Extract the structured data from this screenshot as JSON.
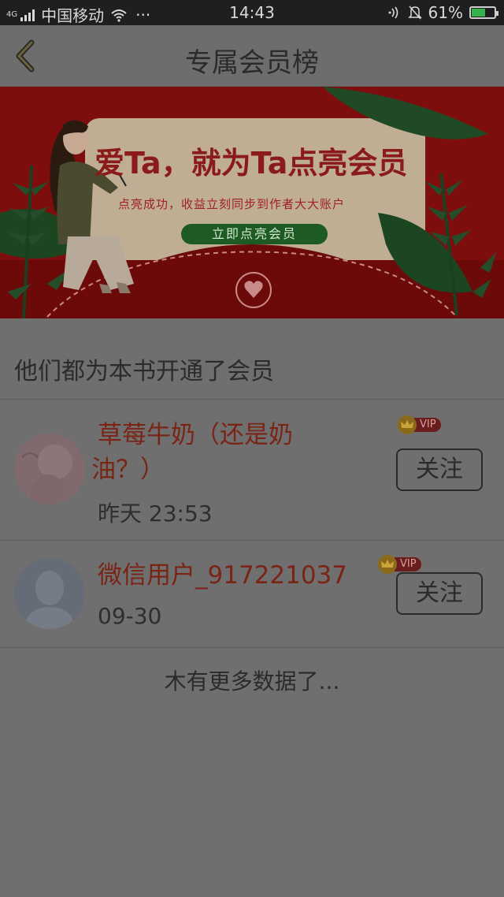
{
  "status_bar": {
    "network_type": "4G",
    "carrier": "中国移动",
    "more": "···",
    "time": "14:43",
    "battery": "61%",
    "battery_level": 0.61
  },
  "header": {
    "title": "专属会员榜"
  },
  "banner": {
    "headline": "爱Ta，就为Ta点亮会员",
    "subtitle": "点亮成功，收益立刻同步到作者大大账户",
    "cta": "立即点亮会员"
  },
  "section": {
    "title": "他们都为本书开通了会员"
  },
  "members": [
    {
      "name_line1": "草莓牛奶（还是奶",
      "name_line2": "油？）",
      "time": "昨天 23:53",
      "badge": "VIP",
      "follow_label": "关注"
    },
    {
      "name": "微信用户_917221037",
      "time": "09-30",
      "badge": "VIP",
      "follow_label": "关注"
    }
  ],
  "footer": {
    "no_more": "木有更多数据了..."
  },
  "colors": {
    "overlay_background": "#6f6f6f",
    "banner_red": "#7d0a0a",
    "name_red": "#7a2416",
    "battery_green": "#37b24d"
  }
}
